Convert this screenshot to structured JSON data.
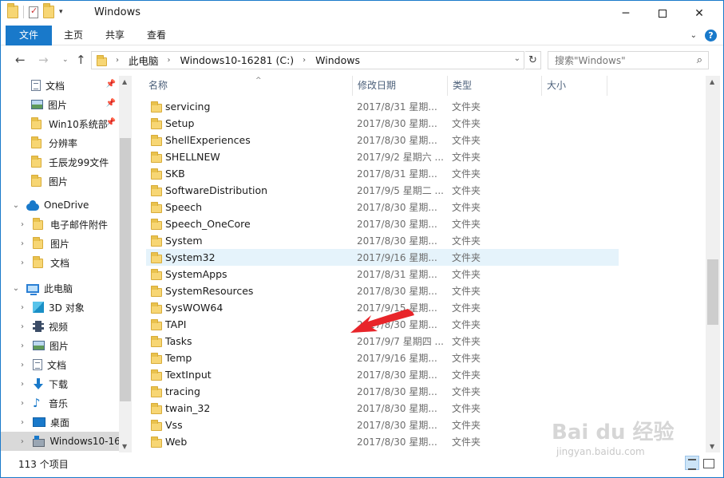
{
  "window": {
    "title": "Windows",
    "controls": {
      "minimize": "─",
      "close": "✕"
    }
  },
  "ribbon": {
    "tabs": [
      "文件",
      "主页",
      "共享",
      "查看"
    ],
    "collapse_glyph": "⌄",
    "help_glyph": "?"
  },
  "address": {
    "back_glyph": "←",
    "forward_glyph": "→",
    "recent_glyph": "⌄",
    "up_glyph": "↑",
    "crumbs": [
      "此电脑",
      "Windows10-16281 (C:)",
      "Windows"
    ],
    "separator_glyph": "›",
    "dropdown_glyph": "⌄",
    "refresh_glyph": "↻",
    "search_placeholder": "搜索\"Windows\"",
    "search_icon_glyph": "⌕"
  },
  "nav": {
    "quick_access": [
      {
        "label": "文档",
        "icon": "documents-icon",
        "pinned": true
      },
      {
        "label": "图片",
        "icon": "pictures-icon",
        "pinned": true
      },
      {
        "label": "Win10系统部",
        "icon": "folder-icon",
        "pinned": true
      },
      {
        "label": "分辨率",
        "icon": "folder-icon",
        "pinned": false
      },
      {
        "label": "壬辰龙99文件",
        "icon": "folder-icon",
        "pinned": false
      },
      {
        "label": "图片",
        "icon": "folder-icon",
        "pinned": false
      }
    ],
    "onedrive": {
      "label": "OneDrive",
      "children": [
        "电子邮件附件",
        "图片",
        "文档"
      ]
    },
    "this_pc": {
      "label": "此电脑",
      "children": [
        {
          "label": "3D 对象",
          "icon": "3d-objects-icon"
        },
        {
          "label": "视频",
          "icon": "videos-icon"
        },
        {
          "label": "图片",
          "icon": "pictures-icon"
        },
        {
          "label": "文档",
          "icon": "documents-icon"
        },
        {
          "label": "下载",
          "icon": "downloads-icon"
        },
        {
          "label": "音乐",
          "icon": "music-icon"
        },
        {
          "label": "桌面",
          "icon": "desktop-icon"
        },
        {
          "label": "Windows10-16",
          "icon": "drive-icon",
          "selected": true
        }
      ]
    },
    "pin_glyph": "📌",
    "expanded_glyph": "⌄",
    "collapsed_glyph": "›"
  },
  "columns": {
    "name": "名称",
    "date": "修改日期",
    "type": "类型",
    "size": "大小",
    "sort_glyph": "^"
  },
  "files": [
    {
      "name": "servicing",
      "date": "2017/8/31 星期...",
      "type": "文件夹"
    },
    {
      "name": "Setup",
      "date": "2017/8/30 星期...",
      "type": "文件夹"
    },
    {
      "name": "ShellExperiences",
      "date": "2017/8/30 星期...",
      "type": "文件夹"
    },
    {
      "name": "SHELLNEW",
      "date": "2017/9/2 星期六 ...",
      "type": "文件夹"
    },
    {
      "name": "SKB",
      "date": "2017/8/31 星期...",
      "type": "文件夹"
    },
    {
      "name": "SoftwareDistribution",
      "date": "2017/9/5 星期二 ...",
      "type": "文件夹"
    },
    {
      "name": "Speech",
      "date": "2017/8/30 星期...",
      "type": "文件夹"
    },
    {
      "name": "Speech_OneCore",
      "date": "2017/8/30 星期...",
      "type": "文件夹"
    },
    {
      "name": "System",
      "date": "2017/8/30 星期...",
      "type": "文件夹"
    },
    {
      "name": "System32",
      "date": "2017/9/16 星期...",
      "type": "文件夹",
      "highlight": true
    },
    {
      "name": "SystemApps",
      "date": "2017/8/31 星期...",
      "type": "文件夹"
    },
    {
      "name": "SystemResources",
      "date": "2017/8/30 星期...",
      "type": "文件夹"
    },
    {
      "name": "SysWOW64",
      "date": "2017/9/15 星期...",
      "type": "文件夹"
    },
    {
      "name": "TAPI",
      "date": "2017/8/30 星期...",
      "type": "文件夹"
    },
    {
      "name": "Tasks",
      "date": "2017/9/7 星期四 ...",
      "type": "文件夹"
    },
    {
      "name": "Temp",
      "date": "2017/9/16 星期...",
      "type": "文件夹"
    },
    {
      "name": "TextInput",
      "date": "2017/8/30 星期...",
      "type": "文件夹"
    },
    {
      "name": "tracing",
      "date": "2017/8/30 星期...",
      "type": "文件夹"
    },
    {
      "name": "twain_32",
      "date": "2017/8/30 星期...",
      "type": "文件夹"
    },
    {
      "name": "Vss",
      "date": "2017/8/30 星期...",
      "type": "文件夹"
    },
    {
      "name": "Web",
      "date": "2017/8/30 星期...",
      "type": "文件夹"
    }
  ],
  "status": {
    "item_count": "113 个项目"
  },
  "scroll_glyphs": {
    "up": "▲",
    "down": "▼"
  },
  "watermark": {
    "main": "Bai du 经验",
    "sub": "jingyan.baidu.com"
  },
  "colors": {
    "accent": "#1979ca",
    "highlight_row": "#e5f3fb",
    "arrow": "#e8252a"
  }
}
